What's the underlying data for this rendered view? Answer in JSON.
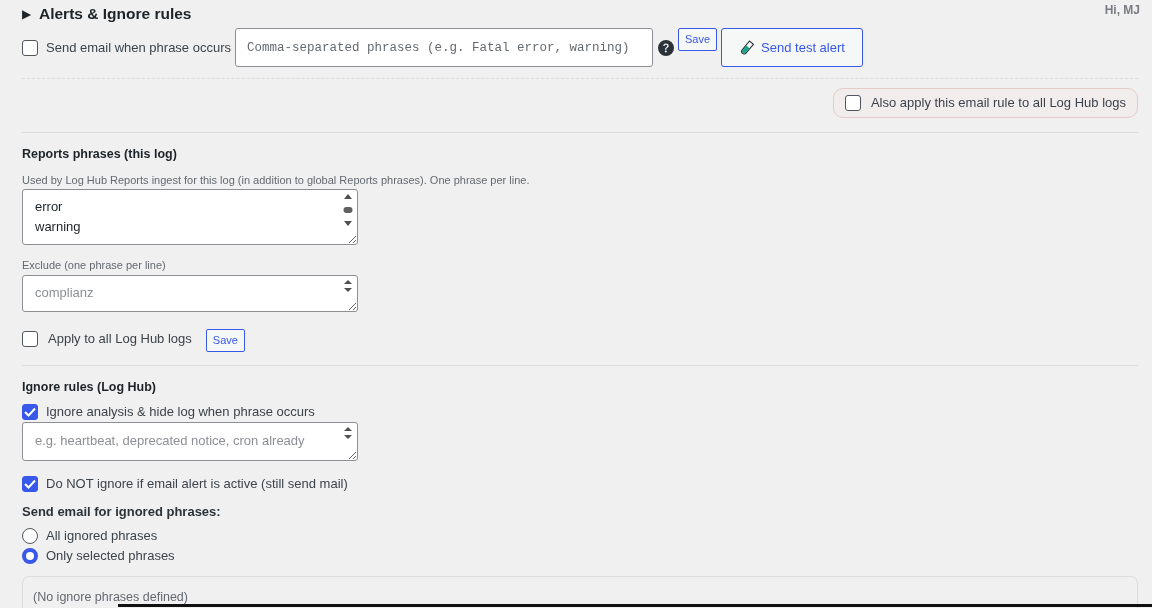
{
  "section": {
    "marker": "▶",
    "title": "Alerts & Ignore rules"
  },
  "user_greeting": "Hi, MJ",
  "email_alert": {
    "enable": {
      "label": "Send email when phrase occurs",
      "checked": false
    },
    "phrases_field": {
      "placeholder": "Comma-separated phrases (e.g. Fatal error, warning)"
    },
    "save_button": "Save",
    "test_button": "Send test alert",
    "apply_all": {
      "label": "Also apply this email rule to all Log Hub logs",
      "checked": false
    }
  },
  "reports": {
    "title": "Reports phrases (this log)",
    "hint": "Used by Log Hub Reports ingest for this log (in addition to global Reports phrases). One phrase per line.",
    "phrases_field": {
      "value": "error\nwarning"
    },
    "exclude_label": "Exclude (one phrase per line)",
    "exclude_field": {
      "placeholder": "complianz"
    },
    "apply_all": {
      "label": "Apply to all Log Hub logs",
      "checked": false
    },
    "save_button": "Save"
  },
  "ignore_rules": {
    "title": "Ignore rules (Log Hub)",
    "ignore_toggle": {
      "label": "Ignore analysis & hide log when phrase occurs",
      "checked": true
    },
    "phrases_field": {
      "placeholder": "e.g. heartbeat, deprecated notice, cron already"
    },
    "keep_email": {
      "label": "Do NOT ignore if email alert is active (still send mail)",
      "checked": true
    },
    "email_scope": {
      "title": "Send email for ignored phrases:",
      "options": [
        {
          "label": "All ignored phrases",
          "selected": false
        },
        {
          "label": "Only selected phrases",
          "selected": true
        }
      ]
    },
    "phrases_list": {
      "empty_text": "(No ignore phrases defined)"
    }
  }
}
